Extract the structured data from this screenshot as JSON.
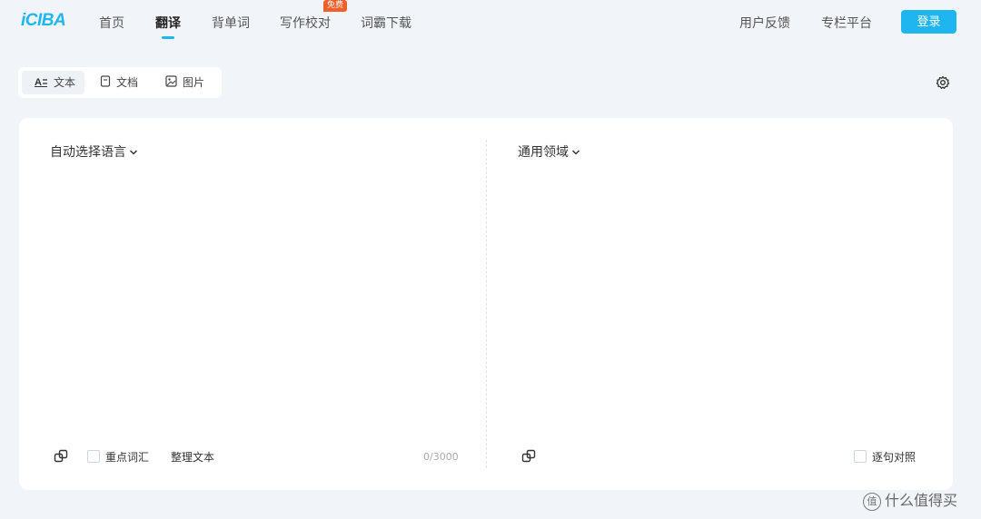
{
  "header": {
    "logo": "iCIBA",
    "nav": [
      {
        "label": "首页"
      },
      {
        "label": "翻译"
      },
      {
        "label": "背单词"
      },
      {
        "label": "写作校对",
        "badge": "免费"
      },
      {
        "label": "词霸下载"
      }
    ],
    "right_links": [
      "用户反馈",
      "专栏平台"
    ],
    "login_label": "登录",
    "accent_color": "#1fb6f0",
    "badge_color": "#f25f2a"
  },
  "mode_tabs": [
    {
      "label": "文本",
      "icon": "text-icon",
      "active": true
    },
    {
      "label": "文档",
      "icon": "document-icon",
      "active": false
    },
    {
      "label": "图片",
      "icon": "image-icon",
      "active": false
    }
  ],
  "source": {
    "language_select": "自动选择语言",
    "input_value": "",
    "key_vocab_label": "重点词汇",
    "tidy_text_label": "整理文本",
    "counter": "0/3000"
  },
  "target": {
    "domain_select": "通用领域",
    "sentence_compare_label": "逐句对照"
  },
  "watermark": {
    "symbol": "值",
    "text": "什么值得买"
  }
}
